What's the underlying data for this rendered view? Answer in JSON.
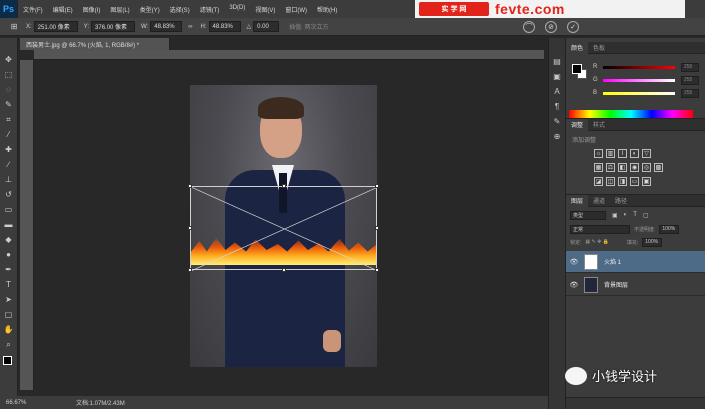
{
  "app": {
    "logo": "Ps"
  },
  "menu": [
    "文件(F)",
    "编辑(E)",
    "图像(I)",
    "图层(L)",
    "类型(Y)",
    "选择(S)",
    "滤镜(T)",
    "3D(D)",
    "视图(V)",
    "窗口(W)",
    "帮助(H)"
  ],
  "watermark": {
    "logo_text": "实 学 网",
    "url": "fevte.com"
  },
  "options": {
    "x_label": "X:",
    "x_value": "251.00 像素",
    "y_label": "Y:",
    "y_value": "376.00 像素",
    "w_label": "W:",
    "w_value": "48.83%",
    "h_label": "H:",
    "h_value": "48.83%",
    "angle_value": "0.00",
    "interp_label": "插值: 两次立方"
  },
  "document_tab": "西装男士.jpg @ 66.7% (火焰, 1, RGB/8#) *",
  "status": {
    "zoom": "66.67%",
    "doc_info": "文档:1.07M/2.43M"
  },
  "color_panel": {
    "tabs": [
      "颜色",
      "色板"
    ],
    "channels": [
      {
        "label": "R",
        "value": "255",
        "gradient": "linear-gradient(to right,#000,#f00)"
      },
      {
        "label": "G",
        "value": "255",
        "gradient": "linear-gradient(to right,#f0f,#fff)"
      },
      {
        "label": "B",
        "value": "255",
        "gradient": "linear-gradient(to right,#ff0,#fff)"
      }
    ]
  },
  "adjust_panel": {
    "tabs": [
      "调整",
      "样式"
    ],
    "title": "添加调整"
  },
  "layers_panel": {
    "tabs": [
      "图层",
      "通道",
      "路径"
    ],
    "kind_label": "类型",
    "blend_mode": "正常",
    "opacity_label": "不透明度:",
    "opacity_value": "100%",
    "lock_label": "锁定:",
    "fill_label": "填充:",
    "fill_value": "100%",
    "layers": [
      {
        "name": "火焰 1",
        "selected": true,
        "thumb": "#ffffff"
      },
      {
        "name": "背景图层",
        "selected": false,
        "thumb": "#22263a"
      }
    ]
  },
  "brand": {
    "name": "小钱学设计"
  }
}
